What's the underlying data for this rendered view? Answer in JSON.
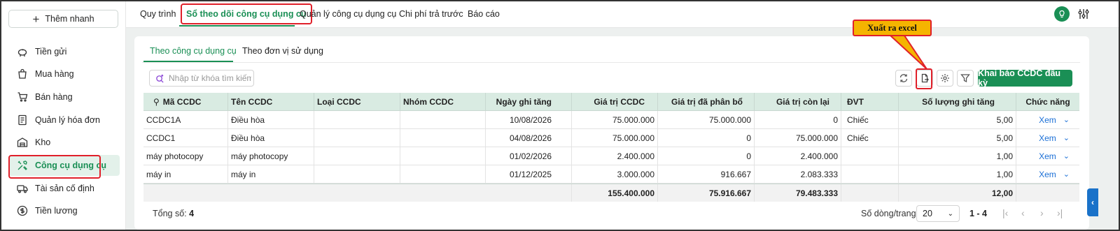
{
  "sidebar": {
    "quick_add": "Thêm nhanh",
    "items": [
      {
        "label": "Tiền gửi",
        "icon": "piggy-bank-icon"
      },
      {
        "label": "Mua hàng",
        "icon": "shopping-bag-icon"
      },
      {
        "label": "Bán hàng",
        "icon": "cart-icon"
      },
      {
        "label": "Quản lý hóa đơn",
        "icon": "invoice-icon"
      },
      {
        "label": "Kho",
        "icon": "warehouse-icon"
      },
      {
        "label": "Công cụ dụng cụ",
        "icon": "tools-icon",
        "active": true
      },
      {
        "label": "Tài sản cố định",
        "icon": "truck-icon"
      },
      {
        "label": "Tiền lương",
        "icon": "dollar-circle-icon"
      }
    ]
  },
  "top_tabs": [
    {
      "label": "Quy trình"
    },
    {
      "label": "Sổ theo dõi công cụ dụng cụ",
      "active": true
    },
    {
      "label": "Quản lý công cụ dụng cụ"
    },
    {
      "label": "Chi phí trả trước"
    },
    {
      "label": "Báo cáo"
    }
  ],
  "sub_tabs": [
    {
      "label": "Theo công cụ dụng cụ",
      "active": true
    },
    {
      "label": "Theo đơn vị sử dụng"
    }
  ],
  "search": {
    "placeholder": "Nhập từ khóa tìm kiếm"
  },
  "toolbar": {
    "primary_button": "Khai báo CCDC đầu kỳ",
    "callout": "Xuất ra excel"
  },
  "table": {
    "headers": [
      "Mã CCDC",
      "Tên CCDC",
      "Loại CCDC",
      "Nhóm CCDC",
      "Ngày ghi tăng",
      "Giá trị CCDC",
      "Giá trị đã phân bổ",
      "Giá trị còn lại",
      "ĐVT",
      "Số lượng ghi tăng",
      "Chức năng"
    ],
    "rows": [
      [
        "CCDC1A",
        "Điều hòa",
        "",
        "",
        "10/08/2026",
        "75.000.000",
        "75.000.000",
        "0",
        "Chiếc",
        "5,00",
        "Xem"
      ],
      [
        "CCDC1",
        "Điều hòa",
        "",
        "",
        "04/08/2026",
        "75.000.000",
        "0",
        "75.000.000",
        "Chiếc",
        "5,00",
        "Xem"
      ],
      [
        "máy photocopy",
        "máy photocopy",
        "",
        "",
        "01/02/2026",
        "2.400.000",
        "0",
        "2.400.000",
        "",
        "1,00",
        "Xem"
      ],
      [
        "máy in",
        "máy in",
        "",
        "",
        "01/12/2025",
        "3.000.000",
        "916.667",
        "2.083.333",
        "",
        "1,00",
        "Xem"
      ]
    ],
    "totals": {
      "gia_tri": "155.400.000",
      "da_phan_bo": "75.916.667",
      "con_lai": "79.483.333",
      "so_luong": "12,00"
    }
  },
  "footer": {
    "total_label": "Tổng số:",
    "total_value": "4",
    "rows_per_page_label": "Số dòng/trang",
    "rows_per_page": "20",
    "page_range": "1 - 4"
  },
  "colors": {
    "accent": "#1a8f55",
    "highlight": "#e0202a",
    "callout": "#f5b400",
    "link": "#1a6fd6"
  }
}
